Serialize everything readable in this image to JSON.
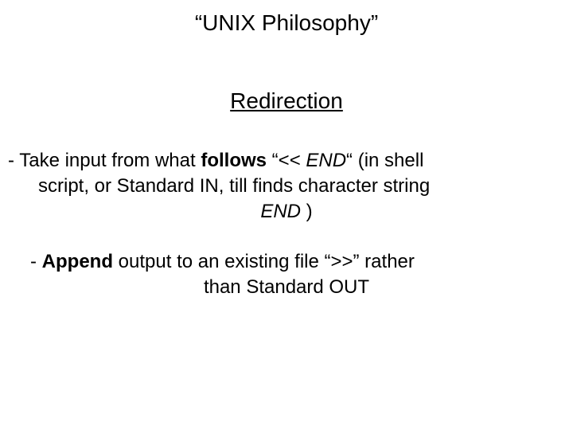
{
  "title": "“UNIX Philosophy”",
  "subtitle": "Redirection",
  "p1": {
    "l1a": "- Take input from what ",
    "l1b": "follows",
    "l1c": " “<< ",
    "l1d": "END",
    "l1e": "“ (in shell",
    "l2": "script, or Standard IN, till finds character string",
    "l3a": "END",
    "l3b": " )"
  },
  "p2": {
    "l1a": "- ",
    "l1b": "Append",
    "l1c": " output to an existing file “>>” rather",
    "l2": "than Standard OUT"
  }
}
